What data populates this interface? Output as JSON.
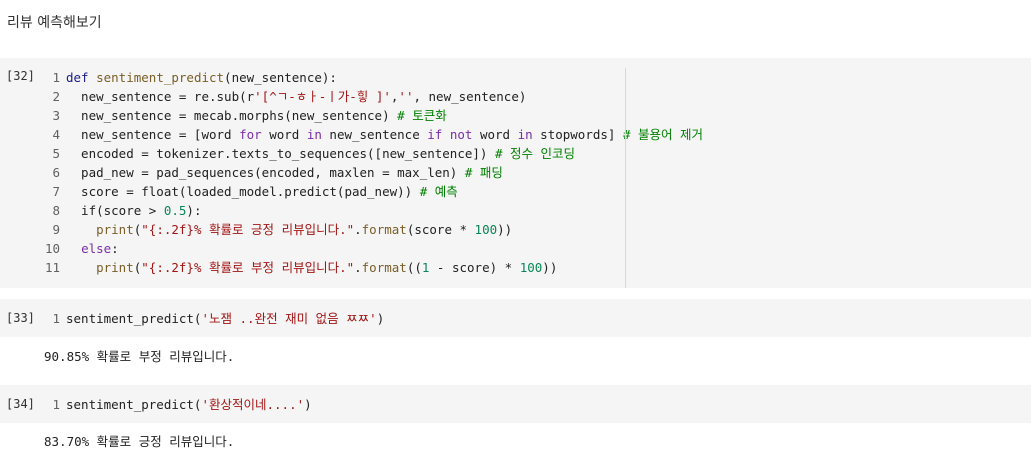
{
  "heading": "리뷰 예측해보기",
  "cells": [
    {
      "prompt": "[32]",
      "lines": [
        {
          "n": "1",
          "tokens": [
            [
              "kw",
              "def "
            ],
            [
              "fn",
              "sentiment_predict"
            ],
            [
              "code",
              "(new_sentence):"
            ]
          ]
        },
        {
          "n": "2",
          "tokens": [
            [
              "code",
              "  new_sentence = re.sub(r"
            ],
            [
              "str",
              "'[^ㄱ-ㅎㅏ-ㅣ가-힣 ]'"
            ],
            [
              "code",
              ","
            ],
            [
              "str",
              "''"
            ],
            [
              "code",
              ", new_sentence)"
            ]
          ]
        },
        {
          "n": "3",
          "tokens": [
            [
              "code",
              "  new_sentence = mecab.morphs(new_sentence) "
            ],
            [
              "cmt",
              "# 토큰화"
            ]
          ]
        },
        {
          "n": "4",
          "tokens": [
            [
              "code",
              "  new_sentence = [word "
            ],
            [
              "kw2",
              "for"
            ],
            [
              "code",
              " word "
            ],
            [
              "kw2",
              "in"
            ],
            [
              "code",
              " new_sentence "
            ],
            [
              "kw2",
              "if"
            ],
            [
              "code",
              " "
            ],
            [
              "kw2",
              "not"
            ],
            [
              "code",
              " word "
            ],
            [
              "kw2",
              "in"
            ],
            [
              "code",
              " stopwords] "
            ],
            [
              "cmt",
              "# 불용어 제거"
            ]
          ]
        },
        {
          "n": "5",
          "tokens": [
            [
              "code",
              "  encoded = tokenizer.texts_to_sequences([new_sentence]) "
            ],
            [
              "cmt",
              "# 정수 인코딩"
            ]
          ]
        },
        {
          "n": "6",
          "tokens": [
            [
              "code",
              "  pad_new = pad_sequences(encoded, maxlen = max_len) "
            ],
            [
              "cmt",
              "# 패딩"
            ]
          ]
        },
        {
          "n": "7",
          "tokens": [
            [
              "code",
              "  score = float(loaded_model.predict(pad_new)) "
            ],
            [
              "cmt",
              "# 예측"
            ]
          ]
        },
        {
          "n": "8",
          "tokens": [
            [
              "code",
              "  if(score > "
            ],
            [
              "num",
              "0.5"
            ],
            [
              "code",
              "):"
            ]
          ]
        },
        {
          "n": "9",
          "tokens": [
            [
              "code",
              "    "
            ],
            [
              "fn",
              "print"
            ],
            [
              "code",
              "("
            ],
            [
              "str",
              "\"{:.2f}% 확률로 긍정 리뷰입니다.\""
            ],
            [
              "code",
              "."
            ],
            [
              "fn",
              "format"
            ],
            [
              "code",
              "(score * "
            ],
            [
              "num",
              "100"
            ],
            [
              "code",
              "))"
            ]
          ]
        },
        {
          "n": "10",
          "tokens": [
            [
              "code",
              "  "
            ],
            [
              "kw2",
              "else"
            ],
            [
              "code",
              ":"
            ]
          ]
        },
        {
          "n": "11",
          "tokens": [
            [
              "code",
              "    "
            ],
            [
              "fn",
              "print"
            ],
            [
              "code",
              "("
            ],
            [
              "str",
              "\"{:.2f}% 확률로 부정 리뷰입니다.\""
            ],
            [
              "code",
              "."
            ],
            [
              "fn",
              "format"
            ],
            [
              "code",
              "(("
            ],
            [
              "num",
              "1"
            ],
            [
              "code",
              " - score) * "
            ],
            [
              "num",
              "100"
            ],
            [
              "code",
              "))"
            ]
          ]
        }
      ]
    },
    {
      "prompt": "[33]",
      "lines": [
        {
          "n": "1",
          "tokens": [
            [
              "code",
              "sentiment_predict("
            ],
            [
              "str",
              "'노잼 ..완전 재미 없음 ㅉㅉ'"
            ],
            [
              "code",
              ")"
            ]
          ]
        }
      ],
      "output": "90.85% 확률로 부정 리뷰입니다."
    },
    {
      "prompt": "[34]",
      "lines": [
        {
          "n": "1",
          "tokens": [
            [
              "code",
              "sentiment_predict("
            ],
            [
              "str",
              "'환상적이네....'"
            ],
            [
              "code",
              ")"
            ]
          ]
        }
      ],
      "output": "83.70% 확률로 긍정 리뷰입니다."
    }
  ]
}
